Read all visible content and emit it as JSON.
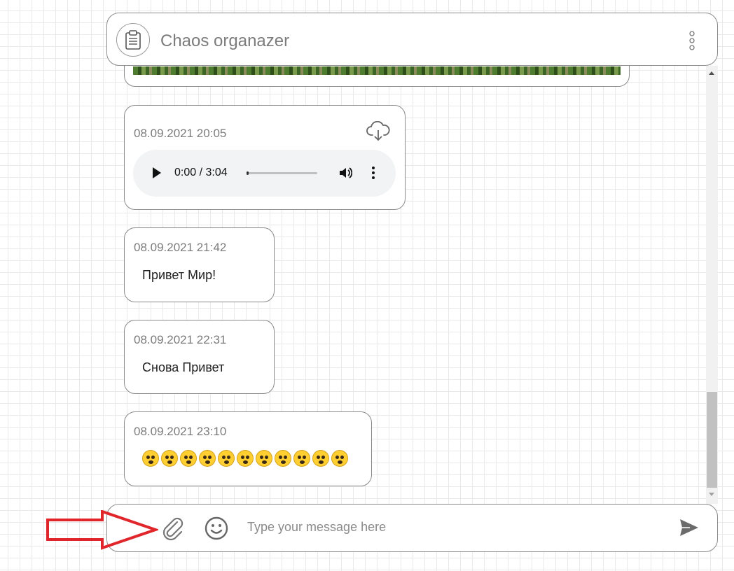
{
  "header": {
    "title": "Chaos organazer",
    "logo_icon": "clipboard-icon",
    "menu_icon": "vertical-dots-icon"
  },
  "messages": [
    {
      "type": "image"
    },
    {
      "type": "audio",
      "date": "08.09.2021 20:05",
      "download_icon": "cloud-download-icon",
      "player": {
        "time": "0:00 / 3:04",
        "progress": 0.02
      }
    },
    {
      "type": "text",
      "date": "08.09.2021 21:42",
      "text": "Привет Мир!"
    },
    {
      "type": "text",
      "date": "08.09.2021 22:31",
      "text": "Снова Привет"
    },
    {
      "type": "emoji",
      "date": "08.09.2021 23:10",
      "emojis": [
        "😵",
        "🙁",
        "🙄",
        "😭",
        "🤢",
        "😠",
        "😲",
        "😭",
        "😇",
        "😨",
        "😨"
      ]
    }
  ],
  "composer": {
    "placeholder": "Type your message here",
    "attach_icon": "paperclip-icon",
    "emoji_icon": "smiley-icon",
    "send_icon": "send-icon"
  },
  "annotation": {
    "arrow_color": "#e0262b"
  }
}
